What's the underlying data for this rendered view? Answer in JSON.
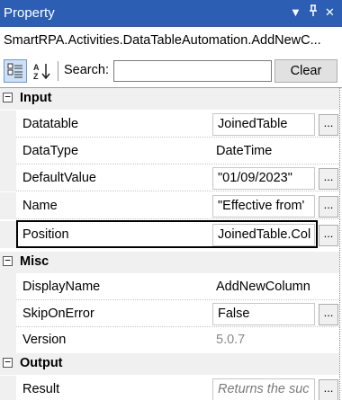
{
  "window": {
    "title": "Property",
    "controls": {
      "dropdown": "▼",
      "pin": "ᵽ",
      "close": "✕"
    }
  },
  "object_name": "SmartRPA.Activities.DataTableAutomation.AddNewC...",
  "toolbar": {
    "search_label": "Search:",
    "search_value": "",
    "clear_label": "Clear"
  },
  "categories": [
    {
      "label": "Input",
      "toggle": "−",
      "properties": [
        {
          "name": "Datatable",
          "value": "JoinedTable"
        },
        {
          "name": "DataType",
          "value": "DateTime"
        },
        {
          "name": "DefaultValue",
          "value": "\"01/09/2023\""
        },
        {
          "name": "Name",
          "value": "\"Effective from'"
        },
        {
          "name": "Position",
          "value": "JoinedTable.Col"
        }
      ]
    },
    {
      "label": "Misc",
      "toggle": "−",
      "properties": [
        {
          "name": "DisplayName",
          "value": "AddNewColumn"
        },
        {
          "name": "SkipOnError",
          "value": "False"
        },
        {
          "name": "Version",
          "value": "5.0.7"
        }
      ]
    },
    {
      "label": "Output",
      "toggle": "−",
      "properties": [
        {
          "name": "Result",
          "value": "Returns the suc"
        }
      ]
    }
  ],
  "ellipsis": "...",
  "colors": {
    "titlebar": "#2c5fb4",
    "category_bg": "#f0f0f0",
    "selected_border": "#000000"
  }
}
